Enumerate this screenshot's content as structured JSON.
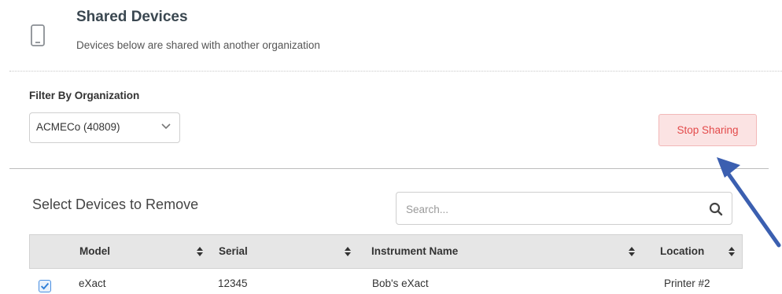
{
  "header": {
    "title": "Shared Devices",
    "subtitle": "Devices below are shared with another organization",
    "icon": "mobile-device-icon"
  },
  "filter": {
    "label": "Filter By Organization",
    "selected": "ACMECo (40809)",
    "icon": "chevron-down-icon"
  },
  "actions": {
    "stop_sharing_label": "Stop Sharing",
    "stop_sharing_color": "#e34a4a",
    "stop_sharing_bg": "#fbe3e3"
  },
  "annotation": {
    "arrow_color": "#3b5fb0"
  },
  "devices": {
    "section_title": "Select Devices to Remove",
    "search_placeholder": "Search...",
    "columns": [
      {
        "label": "Model",
        "sortable": true
      },
      {
        "label": "Serial",
        "sortable": true
      },
      {
        "label": "Instrument Name",
        "sortable": true
      },
      {
        "label": "Location",
        "sortable": true
      }
    ],
    "rows": [
      {
        "checked": true,
        "model": "eXact",
        "serial": "12345",
        "instrument_name": "Bob's eXact",
        "location": "Printer #2"
      }
    ]
  }
}
